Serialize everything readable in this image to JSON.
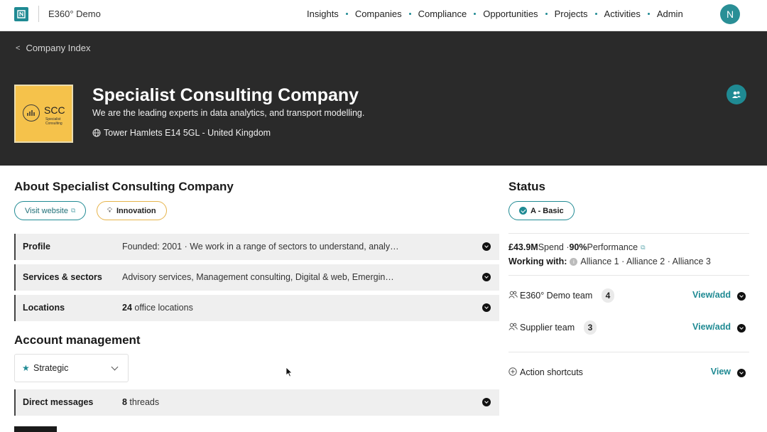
{
  "app": {
    "name": "E360° Demo",
    "avatar_initial": "N",
    "nav": [
      "Insights",
      "Companies",
      "Compliance",
      "Opportunities",
      "Projects",
      "Activities",
      "Admin"
    ],
    "accent": "#1f8a93"
  },
  "header": {
    "breadcrumb": "Company Index",
    "logo": {
      "abbr": "SCC",
      "line1": "Specialist",
      "line2": "Consulting"
    },
    "title": "Specialist Consulting Company",
    "tagline": "We are the leading experts in data analytics, and transport modelling.",
    "location": "Tower Hamlets E14 5GL - United Kingdom"
  },
  "about": {
    "title": "About Specialist Consulting Company",
    "visit_website": "Visit website",
    "tag": "Innovation",
    "rows": [
      {
        "label": "Profile",
        "value": "Founded: 2001 · We work in a range of sectors to understand, analy…"
      },
      {
        "label": "Services & sectors",
        "value": "Advisory services, Management consulting, Digital & web, Emergin…"
      },
      {
        "label": "Locations",
        "value_count": "24",
        "value_text": " office locations"
      }
    ]
  },
  "account": {
    "title": "Account management",
    "select_value": "Strategic",
    "messages_label": "Direct messages",
    "messages_count": "8",
    "messages_text": " threads"
  },
  "status": {
    "title": "Status",
    "badge": "A - Basic",
    "spend": "£43.9M",
    "spend_label": " Spend · ",
    "performance": "90%",
    "performance_label": " Performance",
    "working_with_label": "Working with:",
    "working_with": "Alliance 1 · Alliance 2 · Alliance 3",
    "teams": [
      {
        "name": "E360° Demo team",
        "count": "4",
        "action": "View/add"
      },
      {
        "name": "Supplier team",
        "count": "3",
        "action": "View/add"
      }
    ],
    "shortcuts_label": "Action shortcuts",
    "shortcuts_action": "View"
  }
}
